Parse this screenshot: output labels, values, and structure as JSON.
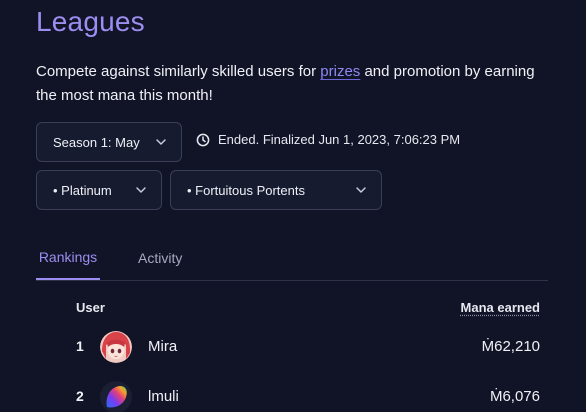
{
  "page": {
    "title": "Leagues",
    "description_before": "Compete against similarly skilled users for ",
    "description_link": "prizes",
    "description_after": " and promotion by earning the most mana this month!"
  },
  "filters": {
    "season": "Season 1: May",
    "status": "Ended. Finalized Jun 1, 2023, 7:06:23 PM",
    "division": "• Platinum",
    "cohort": "• Fortuitous Portents"
  },
  "tabs": {
    "rankings": "Rankings",
    "activity": "Activity",
    "active": "Rankings"
  },
  "table": {
    "col_user": "User",
    "col_mana": "Mana earned",
    "rows": [
      {
        "rank": "1",
        "name": "Mira",
        "mana": "Ṁ62,210",
        "avatar_icon": "anime-girl-avatar"
      },
      {
        "rank": "2",
        "name": "lmuli",
        "mana": "Ṁ6,076",
        "avatar_icon": "gradient-logo-avatar"
      }
    ]
  },
  "colors": {
    "background": "#111427",
    "accent": "#9b8ef0",
    "link": "#8f87f2",
    "border": "#3a3f55"
  }
}
